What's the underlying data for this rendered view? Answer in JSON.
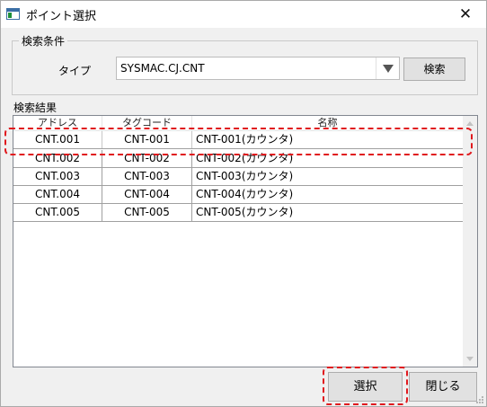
{
  "window": {
    "title": "ポイント選択",
    "close_glyph": "✕"
  },
  "search": {
    "group_label": "検索条件",
    "type_label": "タイプ",
    "type_value": "SYSMAC.CJ.CNT",
    "search_button": "検索"
  },
  "results": {
    "label": "検索結果",
    "columns": [
      "アドレス",
      "タグコード",
      "名称"
    ],
    "rows": [
      [
        "CNT.001",
        "CNT-001",
        "CNT-001(カウンタ)"
      ],
      [
        "CNT.002",
        "CNT-002",
        "CNT-002(カウンタ)"
      ],
      [
        "CNT.003",
        "CNT-003",
        "CNT-003(カウンタ)"
      ],
      [
        "CNT.004",
        "CNT-004",
        "CNT-004(カウンタ)"
      ],
      [
        "CNT.005",
        "CNT-005",
        "CNT-005(カウンタ)"
      ]
    ],
    "selected_row": 0
  },
  "footer": {
    "select_button": "選択",
    "close_button": "閉じる"
  },
  "colors": {
    "highlight": "#e0191e",
    "window_bg": "#f0f0f0"
  },
  "icons": [
    "app-window-icon",
    "close-icon",
    "dropdown-arrow-icon",
    "scroll-up-icon",
    "scroll-down-icon",
    "resize-grip-icon"
  ]
}
